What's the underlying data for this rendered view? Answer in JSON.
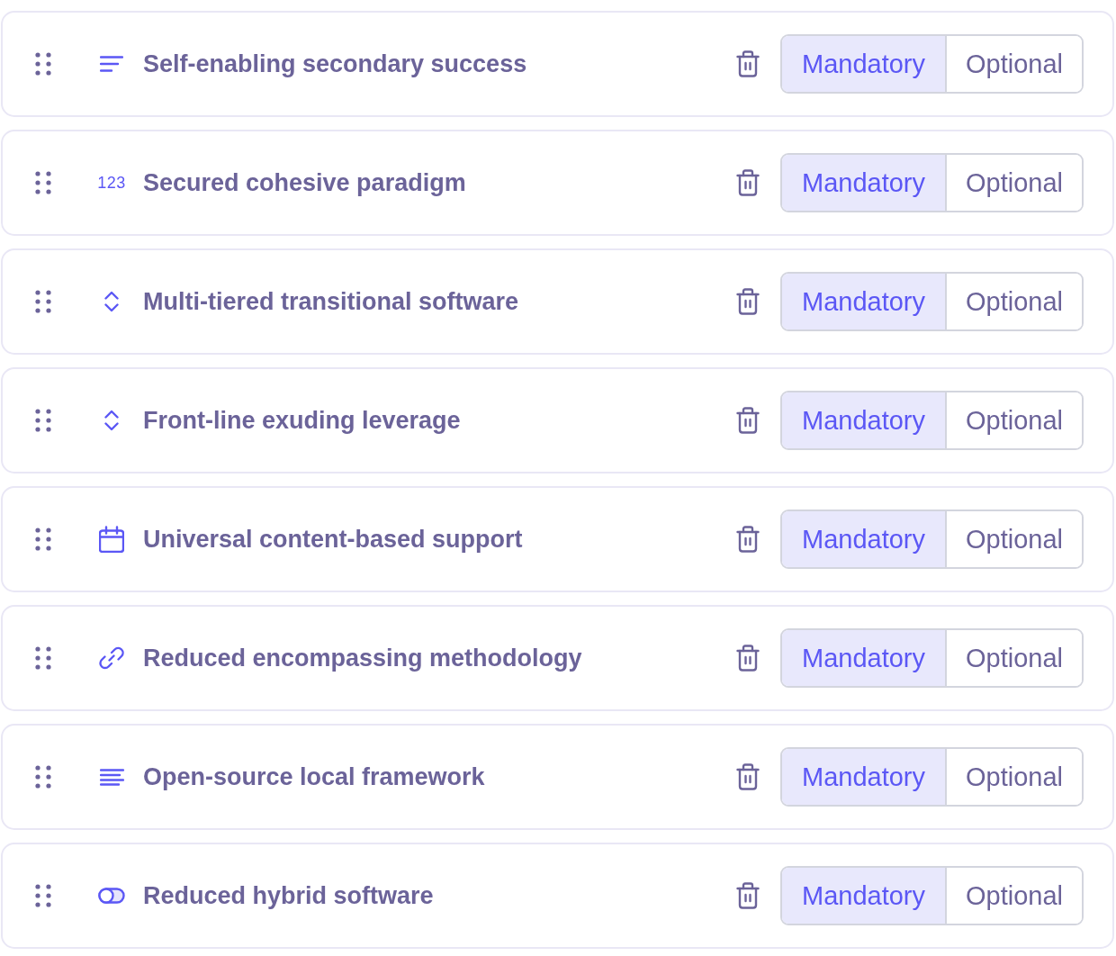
{
  "fields": [
    {
      "kind": "short-text",
      "title": "Self-enabling secondary success",
      "options": [
        {
          "label": "Mandatory",
          "selected": true
        },
        {
          "label": "Optional",
          "selected": false
        }
      ]
    },
    {
      "kind": "number",
      "type_label": "123",
      "title": "Secured cohesive paradigm",
      "options": [
        {
          "label": "Mandatory",
          "selected": true
        },
        {
          "label": "Optional",
          "selected": false
        }
      ]
    },
    {
      "kind": "select",
      "title": "Multi-tiered transitional software",
      "options": [
        {
          "label": "Mandatory",
          "selected": true
        },
        {
          "label": "Optional",
          "selected": false
        }
      ]
    },
    {
      "kind": "select",
      "title": "Front-line exuding leverage",
      "options": [
        {
          "label": "Mandatory",
          "selected": true
        },
        {
          "label": "Optional",
          "selected": false
        }
      ]
    },
    {
      "kind": "date",
      "title": "Universal content-based support",
      "options": [
        {
          "label": "Mandatory",
          "selected": true
        },
        {
          "label": "Optional",
          "selected": false
        }
      ]
    },
    {
      "kind": "link",
      "title": "Reduced encompassing methodology",
      "options": [
        {
          "label": "Mandatory",
          "selected": true
        },
        {
          "label": "Optional",
          "selected": false
        }
      ]
    },
    {
      "kind": "long-text",
      "title": "Open-source local framework",
      "options": [
        {
          "label": "Mandatory",
          "selected": true
        },
        {
          "label": "Optional",
          "selected": false
        }
      ]
    },
    {
      "kind": "toggle",
      "title": "Reduced hybrid software",
      "options": [
        {
          "label": "Mandatory",
          "selected": true
        },
        {
          "label": "Optional",
          "selected": false
        }
      ]
    }
  ]
}
